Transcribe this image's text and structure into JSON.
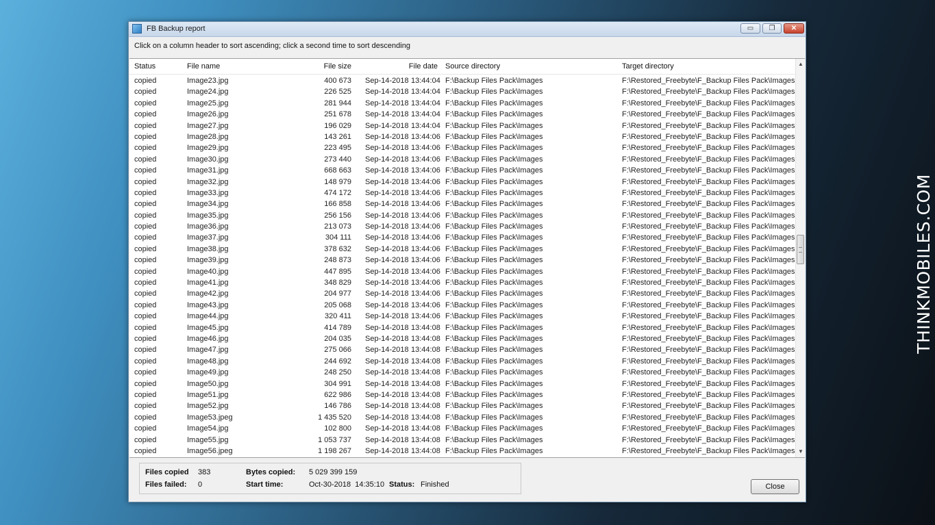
{
  "watermark": "THINKMOBILES.COM",
  "window": {
    "title": "FB Backup report",
    "controls": {
      "minimize": "▭",
      "maximize": "❐",
      "close": "✕"
    }
  },
  "hint": "Click on a column header to sort ascending; click a second time to sort descending",
  "columns": {
    "status": "Status",
    "file_name": "File name",
    "file_size": "File size",
    "file_date": "File date",
    "source_directory": "Source directory",
    "target_directory": "Target directory"
  },
  "rows": [
    {
      "status": "copied",
      "name": "Image23.jpg",
      "size": "400 673",
      "date": "Sep-14-2018",
      "time": "13:44:04",
      "src": "F:\\Backup Files Pack\\Images",
      "tgt": "F:\\Restored_Freebyte\\F_Backup Files Pack\\Images"
    },
    {
      "status": "copied",
      "name": "Image24.jpg",
      "size": "226 525",
      "date": "Sep-14-2018",
      "time": "13:44:04",
      "src": "F:\\Backup Files Pack\\Images",
      "tgt": "F:\\Restored_Freebyte\\F_Backup Files Pack\\Images"
    },
    {
      "status": "copied",
      "name": "Image25.jpg",
      "size": "281 944",
      "date": "Sep-14-2018",
      "time": "13:44:04",
      "src": "F:\\Backup Files Pack\\Images",
      "tgt": "F:\\Restored_Freebyte\\F_Backup Files Pack\\Images"
    },
    {
      "status": "copied",
      "name": "Image26.jpg",
      "size": "251 678",
      "date": "Sep-14-2018",
      "time": "13:44:04",
      "src": "F:\\Backup Files Pack\\Images",
      "tgt": "F:\\Restored_Freebyte\\F_Backup Files Pack\\Images"
    },
    {
      "status": "copied",
      "name": "Image27.jpg",
      "size": "196 029",
      "date": "Sep-14-2018",
      "time": "13:44:04",
      "src": "F:\\Backup Files Pack\\Images",
      "tgt": "F:\\Restored_Freebyte\\F_Backup Files Pack\\Images"
    },
    {
      "status": "copied",
      "name": "Image28.jpg",
      "size": "143 261",
      "date": "Sep-14-2018",
      "time": "13:44:06",
      "src": "F:\\Backup Files Pack\\Images",
      "tgt": "F:\\Restored_Freebyte\\F_Backup Files Pack\\Images"
    },
    {
      "status": "copied",
      "name": "Image29.jpg",
      "size": "223 495",
      "date": "Sep-14-2018",
      "time": "13:44:06",
      "src": "F:\\Backup Files Pack\\Images",
      "tgt": "F:\\Restored_Freebyte\\F_Backup Files Pack\\Images"
    },
    {
      "status": "copied",
      "name": "Image30.jpg",
      "size": "273 440",
      "date": "Sep-14-2018",
      "time": "13:44:06",
      "src": "F:\\Backup Files Pack\\Images",
      "tgt": "F:\\Restored_Freebyte\\F_Backup Files Pack\\Images"
    },
    {
      "status": "copied",
      "name": "Image31.jpg",
      "size": "668 663",
      "date": "Sep-14-2018",
      "time": "13:44:06",
      "src": "F:\\Backup Files Pack\\Images",
      "tgt": "F:\\Restored_Freebyte\\F_Backup Files Pack\\Images"
    },
    {
      "status": "copied",
      "name": "Image32.jpg",
      "size": "148 979",
      "date": "Sep-14-2018",
      "time": "13:44:06",
      "src": "F:\\Backup Files Pack\\Images",
      "tgt": "F:\\Restored_Freebyte\\F_Backup Files Pack\\Images"
    },
    {
      "status": "copied",
      "name": "Image33.jpg",
      "size": "474 172",
      "date": "Sep-14-2018",
      "time": "13:44:06",
      "src": "F:\\Backup Files Pack\\Images",
      "tgt": "F:\\Restored_Freebyte\\F_Backup Files Pack\\Images"
    },
    {
      "status": "copied",
      "name": "Image34.jpg",
      "size": "166 858",
      "date": "Sep-14-2018",
      "time": "13:44:06",
      "src": "F:\\Backup Files Pack\\Images",
      "tgt": "F:\\Restored_Freebyte\\F_Backup Files Pack\\Images"
    },
    {
      "status": "copied",
      "name": "Image35.jpg",
      "size": "256 156",
      "date": "Sep-14-2018",
      "time": "13:44:06",
      "src": "F:\\Backup Files Pack\\Images",
      "tgt": "F:\\Restored_Freebyte\\F_Backup Files Pack\\Images"
    },
    {
      "status": "copied",
      "name": "Image36.jpg",
      "size": "213 073",
      "date": "Sep-14-2018",
      "time": "13:44:06",
      "src": "F:\\Backup Files Pack\\Images",
      "tgt": "F:\\Restored_Freebyte\\F_Backup Files Pack\\Images"
    },
    {
      "status": "copied",
      "name": "Image37.jpg",
      "size": "304 111",
      "date": "Sep-14-2018",
      "time": "13:44:06",
      "src": "F:\\Backup Files Pack\\Images",
      "tgt": "F:\\Restored_Freebyte\\F_Backup Files Pack\\Images"
    },
    {
      "status": "copied",
      "name": "Image38.jpg",
      "size": "378 632",
      "date": "Sep-14-2018",
      "time": "13:44:06",
      "src": "F:\\Backup Files Pack\\Images",
      "tgt": "F:\\Restored_Freebyte\\F_Backup Files Pack\\Images"
    },
    {
      "status": "copied",
      "name": "Image39.jpg",
      "size": "248 873",
      "date": "Sep-14-2018",
      "time": "13:44:06",
      "src": "F:\\Backup Files Pack\\Images",
      "tgt": "F:\\Restored_Freebyte\\F_Backup Files Pack\\Images"
    },
    {
      "status": "copied",
      "name": "Image40.jpg",
      "size": "447 895",
      "date": "Sep-14-2018",
      "time": "13:44:06",
      "src": "F:\\Backup Files Pack\\Images",
      "tgt": "F:\\Restored_Freebyte\\F_Backup Files Pack\\Images"
    },
    {
      "status": "copied",
      "name": "Image41.jpg",
      "size": "348 829",
      "date": "Sep-14-2018",
      "time": "13:44:06",
      "src": "F:\\Backup Files Pack\\Images",
      "tgt": "F:\\Restored_Freebyte\\F_Backup Files Pack\\Images"
    },
    {
      "status": "copied",
      "name": "Image42.jpg",
      "size": "204 977",
      "date": "Sep-14-2018",
      "time": "13:44:06",
      "src": "F:\\Backup Files Pack\\Images",
      "tgt": "F:\\Restored_Freebyte\\F_Backup Files Pack\\Images"
    },
    {
      "status": "copied",
      "name": "Image43.jpg",
      "size": "205 068",
      "date": "Sep-14-2018",
      "time": "13:44:06",
      "src": "F:\\Backup Files Pack\\Images",
      "tgt": "F:\\Restored_Freebyte\\F_Backup Files Pack\\Images"
    },
    {
      "status": "copied",
      "name": "Image44.jpg",
      "size": "320 411",
      "date": "Sep-14-2018",
      "time": "13:44:06",
      "src": "F:\\Backup Files Pack\\Images",
      "tgt": "F:\\Restored_Freebyte\\F_Backup Files Pack\\Images"
    },
    {
      "status": "copied",
      "name": "Image45.jpg",
      "size": "414 789",
      "date": "Sep-14-2018",
      "time": "13:44:08",
      "src": "F:\\Backup Files Pack\\Images",
      "tgt": "F:\\Restored_Freebyte\\F_Backup Files Pack\\Images"
    },
    {
      "status": "copied",
      "name": "Image46.jpg",
      "size": "204 035",
      "date": "Sep-14-2018",
      "time": "13:44:08",
      "src": "F:\\Backup Files Pack\\Images",
      "tgt": "F:\\Restored_Freebyte\\F_Backup Files Pack\\Images"
    },
    {
      "status": "copied",
      "name": "Image47.jpg",
      "size": "275 066",
      "date": "Sep-14-2018",
      "time": "13:44:08",
      "src": "F:\\Backup Files Pack\\Images",
      "tgt": "F:\\Restored_Freebyte\\F_Backup Files Pack\\Images"
    },
    {
      "status": "copied",
      "name": "Image48.jpg",
      "size": "244 692",
      "date": "Sep-14-2018",
      "time": "13:44:08",
      "src": "F:\\Backup Files Pack\\Images",
      "tgt": "F:\\Restored_Freebyte\\F_Backup Files Pack\\Images"
    },
    {
      "status": "copied",
      "name": "Image49.jpg",
      "size": "248 250",
      "date": "Sep-14-2018",
      "time": "13:44:08",
      "src": "F:\\Backup Files Pack\\Images",
      "tgt": "F:\\Restored_Freebyte\\F_Backup Files Pack\\Images"
    },
    {
      "status": "copied",
      "name": "Image50.jpg",
      "size": "304 991",
      "date": "Sep-14-2018",
      "time": "13:44:08",
      "src": "F:\\Backup Files Pack\\Images",
      "tgt": "F:\\Restored_Freebyte\\F_Backup Files Pack\\Images"
    },
    {
      "status": "copied",
      "name": "Image51.jpg",
      "size": "622 986",
      "date": "Sep-14-2018",
      "time": "13:44:08",
      "src": "F:\\Backup Files Pack\\Images",
      "tgt": "F:\\Restored_Freebyte\\F_Backup Files Pack\\Images"
    },
    {
      "status": "copied",
      "name": "Image52.jpg",
      "size": "146 786",
      "date": "Sep-14-2018",
      "time": "13:44:08",
      "src": "F:\\Backup Files Pack\\Images",
      "tgt": "F:\\Restored_Freebyte\\F_Backup Files Pack\\Images"
    },
    {
      "status": "copied",
      "name": "Image53.jpeg",
      "size": "1 435 520",
      "date": "Sep-14-2018",
      "time": "13:44:08",
      "src": "F:\\Backup Files Pack\\Images",
      "tgt": "F:\\Restored_Freebyte\\F_Backup Files Pack\\Images"
    },
    {
      "status": "copied",
      "name": "Image54.jpg",
      "size": "102 800",
      "date": "Sep-14-2018",
      "time": "13:44:08",
      "src": "F:\\Backup Files Pack\\Images",
      "tgt": "F:\\Restored_Freebyte\\F_Backup Files Pack\\Images"
    },
    {
      "status": "copied",
      "name": "Image55.jpg",
      "size": "1 053 737",
      "date": "Sep-14-2018",
      "time": "13:44:08",
      "src": "F:\\Backup Files Pack\\Images",
      "tgt": "F:\\Restored_Freebyte\\F_Backup Files Pack\\Images"
    },
    {
      "status": "copied",
      "name": "Image56.jpeg",
      "size": "1 198 267",
      "date": "Sep-14-2018",
      "time": "13:44:08",
      "src": "F:\\Backup Files Pack\\Images",
      "tgt": "F:\\Restored_Freebyte\\F_Backup Files Pack\\Images"
    }
  ],
  "scrollbar": {
    "up_arrow": "▲",
    "down_arrow": "▼"
  },
  "summary": {
    "files_copied_label": "Files copied",
    "files_copied_value": "383",
    "files_failed_label": "Files failed:",
    "files_failed_value": "0",
    "bytes_copied_label": "Bytes copied:",
    "bytes_copied_value": "5 029 399 159",
    "start_time_label": "Start time:",
    "start_time_value": "Oct-30-2018  14:35:10",
    "status_label": "Status:",
    "status_value": "Finished"
  },
  "close_button": "Close"
}
